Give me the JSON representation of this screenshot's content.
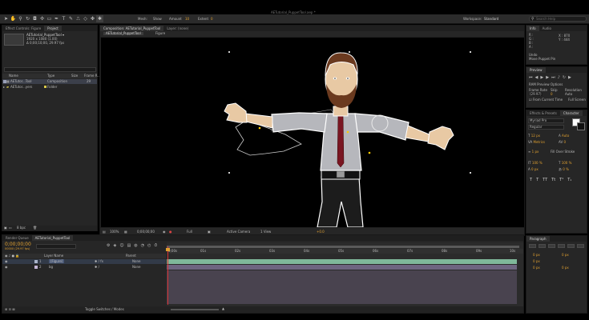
{
  "app": {
    "title": "AETutorial_PuppetTool.aep *"
  },
  "toolbar": {
    "tools": [
      "selection-tool",
      "hand-tool",
      "zoom-tool",
      "rotate-tool",
      "camera-tool",
      "pan-behind-tool",
      "rectangle-tool",
      "pen-tool",
      "type-tool",
      "brush-tool",
      "clone-stamp-tool",
      "eraser-tool",
      "roto-brush-tool",
      "puppet-pin-tool"
    ],
    "menu": [
      "Mesh:",
      "Show",
      "Amount",
      "Extent"
    ],
    "amount_value": "10",
    "extent_value": "0",
    "workspace_label": "Workspace:",
    "workspace_value": "Standard",
    "search_placeholder": "Search Help"
  },
  "project": {
    "tabs": [
      "Effect Controls: Figure",
      "Project"
    ],
    "item_name": "AETutorial_PuppetTool ▾",
    "item_size": "1920 x 1080 (1.00)",
    "item_duration": "Δ 0;00;10;00, 29.97 fps",
    "columns": [
      "Name",
      "Type",
      "Size",
      "Frame R..."
    ],
    "rows": [
      {
        "name": "AETutor...Tool",
        "type": "Composition",
        "rate": "29",
        "color": "#9aa0b8"
      },
      {
        "name": "AETutor...yers",
        "type": "Folder",
        "rate": "",
        "color": "#d8c84a"
      }
    ],
    "bpc": "8 bpc"
  },
  "composition": {
    "tabs": [
      "Composition: AETutorial_PuppetTool",
      "Layer: (none)"
    ],
    "breadcrumbs": [
      "AETutorial_PuppetTool",
      "Figure"
    ],
    "footer": {
      "zoom": "100%",
      "timecode": "0;00;00;00",
      "resolution": "Full",
      "camera": "Active Camera",
      "view": "1 View",
      "exposure": "+0.0"
    }
  },
  "info": {
    "tabs": [
      "Info",
      "Audio"
    ],
    "r": "R :",
    "g": "G :",
    "b": "B :",
    "a": "A :",
    "x": "X : 870",
    "y": "Y : 444",
    "tool_label": "Undo",
    "tool_text": "Move Puppet Pin"
  },
  "preview": {
    "tab": "Preview",
    "ram_label": "RAM Preview Options",
    "frame_rate_label": "Frame Rate",
    "skip_label": "Skip",
    "resolution_label": "Resolution",
    "frame_rate_value": "(29.97)",
    "skip_value": "0",
    "resolution_value": "Auto",
    "from_current": "From Current Time",
    "full_screen": "Full Screen"
  },
  "character": {
    "tabs": [
      "Effects & Presets",
      "Character"
    ],
    "font_value": "Myriad Pro",
    "style_value": "Regular",
    "size_value": "12 px",
    "leading_value": "Auto",
    "kerning_value": "Metrics",
    "tracking_value": "0",
    "stroke_value": "1 px",
    "stroke_type": "Fill Over Stroke",
    "scale_v": "100 %",
    "scale_h": "100 %",
    "baseline": "0 px",
    "tsume": "0 %"
  },
  "paragraph": {
    "tabs": [
      "Paragraph"
    ],
    "fields": [
      "0 px",
      "0 px",
      "0 px",
      "0 px",
      "0 px"
    ]
  },
  "timeline": {
    "tabs": [
      "Render Queue",
      "AETutorial_PuppetTool"
    ],
    "timecode": "0;00;00;00",
    "frame_info": "00000 (29.97 fps)",
    "columns": {
      "layer_name": "Layer Name",
      "parent": "Parent"
    },
    "layers": [
      {
        "num": "1",
        "name": "[Figure]",
        "parent": "None",
        "color": "#a9b3c9"
      },
      {
        "num": "2",
        "name": "bg",
        "parent": "None",
        "color": "#c5b6d6"
      }
    ],
    "ruler": [
      "0;00s",
      "01s",
      "02s",
      "03s",
      "04s",
      "05s",
      "06s",
      "07s",
      "08s",
      "09s",
      "10s"
    ],
    "footer": "Toggle Switches / Modes"
  },
  "colors": {
    "shirt": "#b6b7bc",
    "tie": "#7a1622",
    "pants": "#1a1a1a",
    "skin": "#e8c9a4",
    "hair": "#6b3a1f",
    "timecode": "#e0a030",
    "track_green": "#7fb89a",
    "track_purple": "#6e6580",
    "playhead": "#d42e2e"
  }
}
